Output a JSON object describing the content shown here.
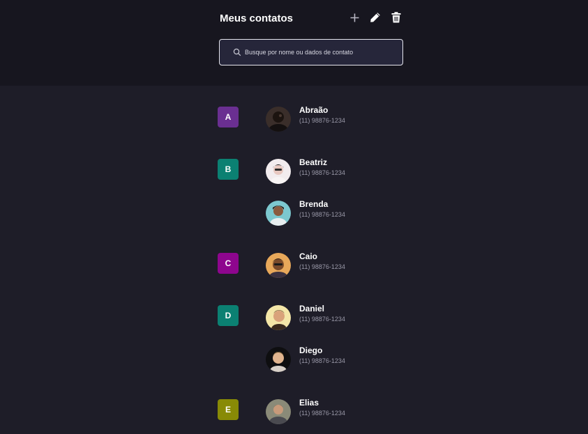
{
  "header": {
    "title": "Meus contatos",
    "actions": [
      {
        "name": "add",
        "icon": "plus-icon"
      },
      {
        "name": "edit",
        "icon": "pencil-icon"
      },
      {
        "name": "delete",
        "icon": "trash-icon"
      }
    ]
  },
  "search": {
    "placeholder": "Busque por nome ou dados de contato",
    "value": "",
    "icon": "search-icon"
  },
  "groups": [
    {
      "letter": "A",
      "color": "#6a2f91",
      "contacts": [
        {
          "name": "Abraão",
          "phone": "(11) 98876-1234"
        }
      ]
    },
    {
      "letter": "B",
      "color": "#0b8072",
      "contacts": [
        {
          "name": "Beatriz",
          "phone": "(11) 98876-1234"
        },
        {
          "name": "Brenda",
          "phone": "(11) 98876-1234"
        }
      ]
    },
    {
      "letter": "C",
      "color": "#8e068e",
      "contacts": [
        {
          "name": "Caio",
          "phone": "(11) 98876-1234"
        }
      ]
    },
    {
      "letter": "D",
      "color": "#0b8072",
      "contacts": [
        {
          "name": "Daniel",
          "phone": "(11) 98876-1234"
        },
        {
          "name": "Diego",
          "phone": "(11) 98876-1234"
        }
      ]
    },
    {
      "letter": "E",
      "color": "#888a06",
      "contacts": [
        {
          "name": "Elias",
          "phone": "(11) 98876-1234"
        }
      ]
    }
  ]
}
